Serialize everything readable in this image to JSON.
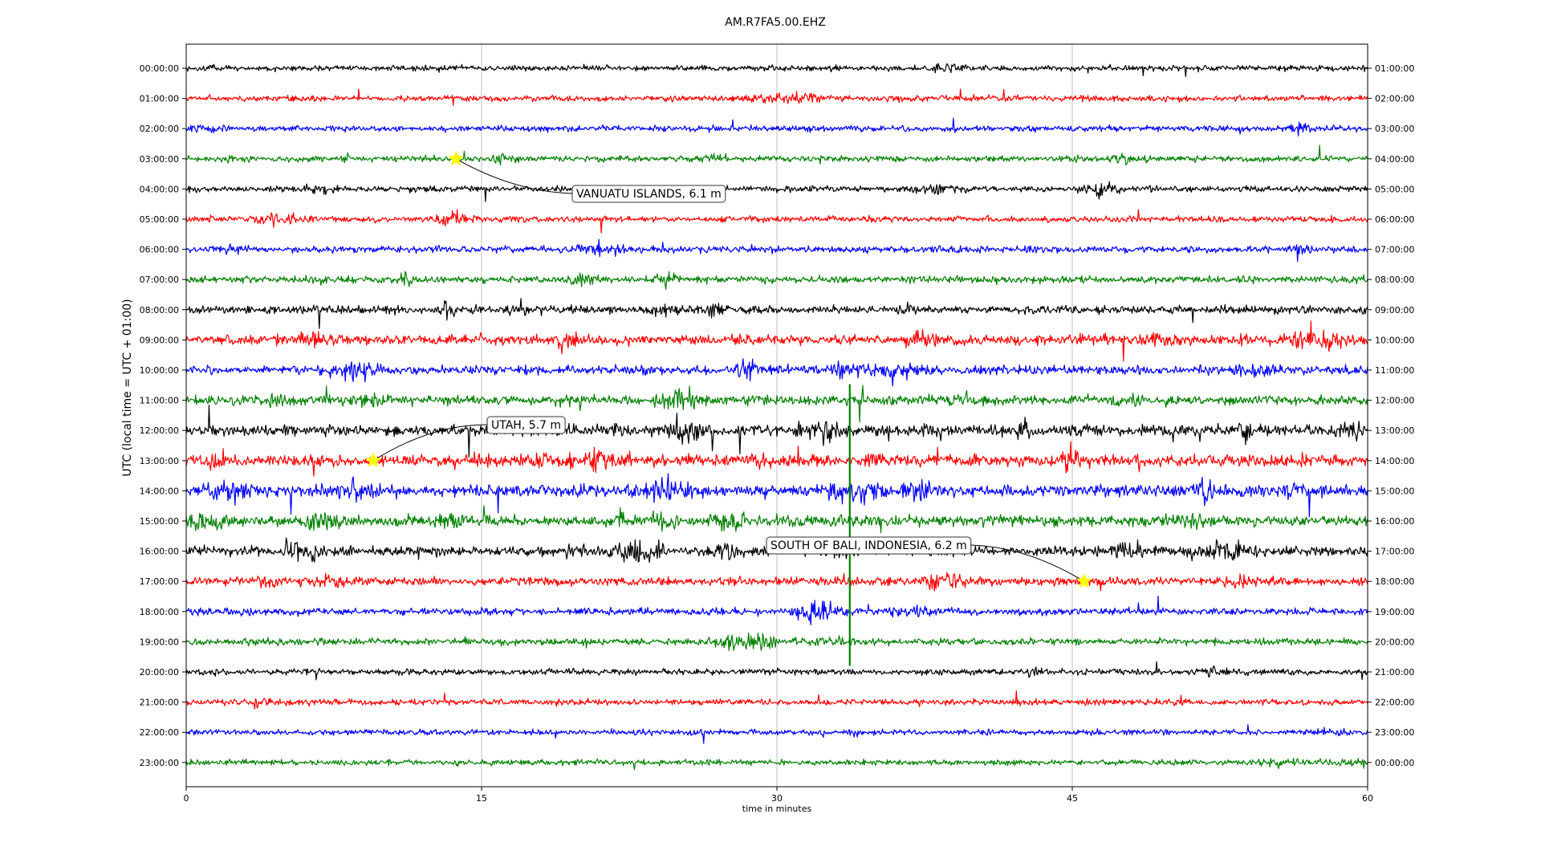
{
  "chart_data": {
    "type": "line",
    "title": "AM.R7FA5.00.EHZ",
    "xlabel": "time in minutes",
    "ylabel": "UTC (local time = UTC + 01:00)",
    "xlim": [
      0,
      60
    ],
    "x_ticks": [
      0,
      15,
      30,
      45,
      60
    ],
    "x_tick_labels": [
      "0",
      "15",
      "30",
      "45",
      "60"
    ],
    "grid": "vertical",
    "trace_colors": [
      "#000000",
      "#ff0000",
      "#0000ff",
      "#008000"
    ],
    "left_tick_labels": [
      "00:00:00",
      "01:00:00",
      "02:00:00",
      "03:00:00",
      "04:00:00",
      "05:00:00",
      "06:00:00",
      "07:00:00",
      "08:00:00",
      "09:00:00",
      "10:00:00",
      "11:00:00",
      "12:00:00",
      "13:00:00",
      "14:00:00",
      "15:00:00",
      "16:00:00",
      "17:00:00",
      "18:00:00",
      "19:00:00",
      "20:00:00",
      "21:00:00",
      "22:00:00",
      "23:00:00"
    ],
    "right_tick_labels": [
      "01:00:00",
      "02:00:00",
      "03:00:00",
      "04:00:00",
      "05:00:00",
      "06:00:00",
      "07:00:00",
      "08:00:00",
      "09:00:00",
      "10:00:00",
      "11:00:00",
      "12:00:00",
      "13:00:00",
      "14:00:00",
      "15:00:00",
      "16:00:00",
      "17:00:00",
      "18:00:00",
      "19:00:00",
      "20:00:00",
      "21:00:00",
      "22:00:00",
      "23:00:00",
      "00:00:00"
    ],
    "trace_activity": [
      0.35,
      0.4,
      0.4,
      0.45,
      0.45,
      0.4,
      0.55,
      0.6,
      0.8,
      1.1,
      1.0,
      1.1,
      1.3,
      1.5,
      1.5,
      1.3,
      1.1,
      0.8,
      0.6,
      0.55,
      0.4,
      0.4,
      0.35,
      0.35
    ],
    "events": [
      {
        "label": "VANUATU ISLANDS, 6.1 m",
        "hour": 3,
        "minute": 13.7,
        "marker_color": "#ffff00"
      },
      {
        "label": "UTAH, 5.7 m",
        "hour": 13,
        "minute": 9.5,
        "marker_color": "#ffff00"
      },
      {
        "label": "SOUTH OF BALI, INDONESIA, 6.2 m",
        "hour": 17,
        "minute": 45.6,
        "marker_color": "#ffff00"
      }
    ]
  }
}
